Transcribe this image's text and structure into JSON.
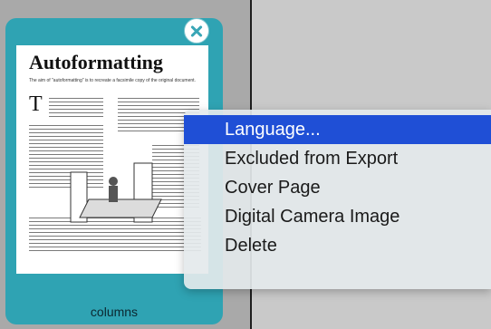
{
  "thumbnail": {
    "title": "Autoformatting",
    "subtitle": "The aim of \"autoformatting\" is to recreate a facsimile copy of the original document.",
    "dropcap": "T",
    "caption": "columns"
  },
  "context_menu": {
    "items": [
      {
        "label": "Language...",
        "selected": true
      },
      {
        "label": "Excluded from Export",
        "selected": false
      },
      {
        "label": "Cover Page",
        "selected": false
      },
      {
        "label": "Digital Camera Image",
        "selected": false
      },
      {
        "label": "Delete",
        "selected": false
      }
    ]
  },
  "colors": {
    "card": "#2fa3b3",
    "selection": "#1f4fd6",
    "menu_background": "#e4e9eb"
  }
}
